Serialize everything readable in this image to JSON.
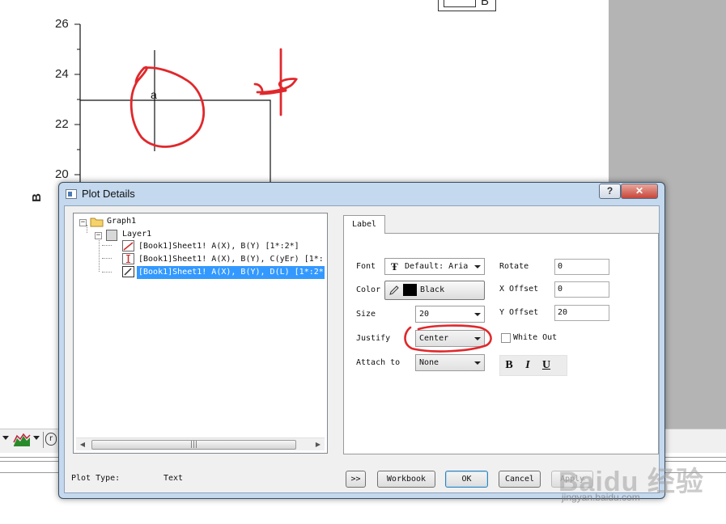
{
  "graph": {
    "y_axis_title": "B",
    "y_ticks": [
      "26",
      "24",
      "22",
      "20"
    ],
    "point_label": "a",
    "legend_label": "B"
  },
  "dialog": {
    "title": "Plot Details",
    "help_label": "?",
    "close_label": "✕",
    "tree": {
      "root": "Graph1",
      "layer": "Layer1",
      "plots": [
        "[Book1]Sheet1! A(X), B(Y) [1*:2*]",
        "[Book1]Sheet1! A(X), B(Y), C(yEr) [1*:",
        "[Book1]Sheet1! A(X), B(Y), D(L) [1*:2*"
      ],
      "selected_index": 2
    },
    "tab": "Label",
    "fields": {
      "font_label": "Font",
      "font_value": "Default: Aria",
      "color_label": "Color",
      "color_value": "Black",
      "size_label": "Size",
      "size_value": "20",
      "justify_label": "Justify",
      "justify_value": "Center",
      "attach_label": "Attach to",
      "attach_value": "None",
      "rotate_label": "Rotate",
      "rotate_value": "0",
      "x_offset_label": "X Offset",
      "x_offset_value": "0",
      "y_offset_label": "Y Offset",
      "y_offset_value": "20",
      "white_out_label": "White Out",
      "white_out_checked": false,
      "bold_label": "B",
      "italic_label": "I",
      "underline_label": "U"
    },
    "footer": {
      "plot_type_label": "Plot Type:",
      "plot_type_value": "Text",
      "more_label": ">>",
      "workbook_label": "Workbook",
      "ok_label": "OK",
      "cancel_label": "Cancel",
      "apply_label": "Apply"
    }
  },
  "watermark": {
    "logo": "Baidu 经验",
    "url": "jingyan.baidu.com"
  },
  "colors": {
    "annotation_red": "#e0282c",
    "selection_blue": "#3399ff",
    "dialog_frame": "#c4d8ee"
  }
}
